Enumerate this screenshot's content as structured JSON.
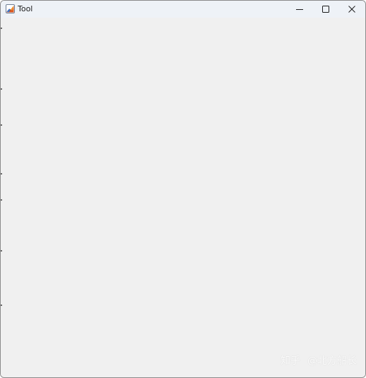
{
  "window": {
    "title": "Tool",
    "app_icon": "matlab-membrane-icon",
    "controls": {
      "minimize": "minimize-icon",
      "maximize": "maximize-icon",
      "close": "close-icon"
    }
  },
  "watermark": {
    "platform": "知乎",
    "author": "@北方船长"
  },
  "colors": {
    "titlebar": "#eef2f7",
    "client_background": "#f0f0f0",
    "border": "#8a8a8a"
  }
}
